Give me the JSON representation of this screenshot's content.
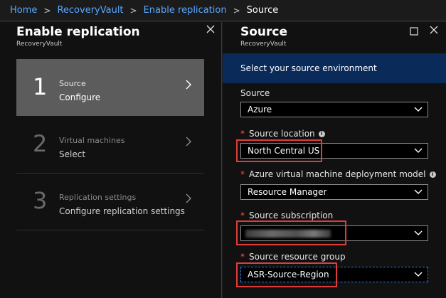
{
  "breadcrumb": {
    "items": [
      "Home",
      "RecoveryVault",
      "Enable replication"
    ],
    "current": "Source"
  },
  "left_blade": {
    "title": "Enable replication",
    "subtitle": "RecoveryVault",
    "close_icon": "close-icon",
    "steps": [
      {
        "number": "1",
        "title": "Source",
        "action": "Configure",
        "active": true
      },
      {
        "number": "2",
        "title": "Virtual machines",
        "action": "Select",
        "active": false
      },
      {
        "number": "3",
        "title": "Replication settings",
        "action": "Configure replication settings",
        "active": false
      }
    ]
  },
  "right_blade": {
    "title": "Source",
    "subtitle": "RecoveryVault",
    "maximize_icon": "maximize-icon",
    "close_icon": "close-icon",
    "banner": "Select your source environment",
    "fields": {
      "source": {
        "label": "Source",
        "value": "Azure",
        "required": false
      },
      "location": {
        "label": "Source location",
        "value": "North Central US",
        "required": true,
        "info": true
      },
      "deployment_model": {
        "label": "Azure virtual machine deployment model",
        "value": "Resource Manager",
        "required": true,
        "info": true
      },
      "subscription": {
        "label": "Source subscription",
        "value": "",
        "required": true,
        "redacted": true
      },
      "resource_group": {
        "label": "Source resource group",
        "value": "ASR-Source-Region",
        "required": true
      }
    }
  },
  "colors": {
    "link": "#5aa6ff",
    "banner": "#0a2a5a",
    "highlight": "#e23b3b",
    "required": "#ff4d4d"
  }
}
